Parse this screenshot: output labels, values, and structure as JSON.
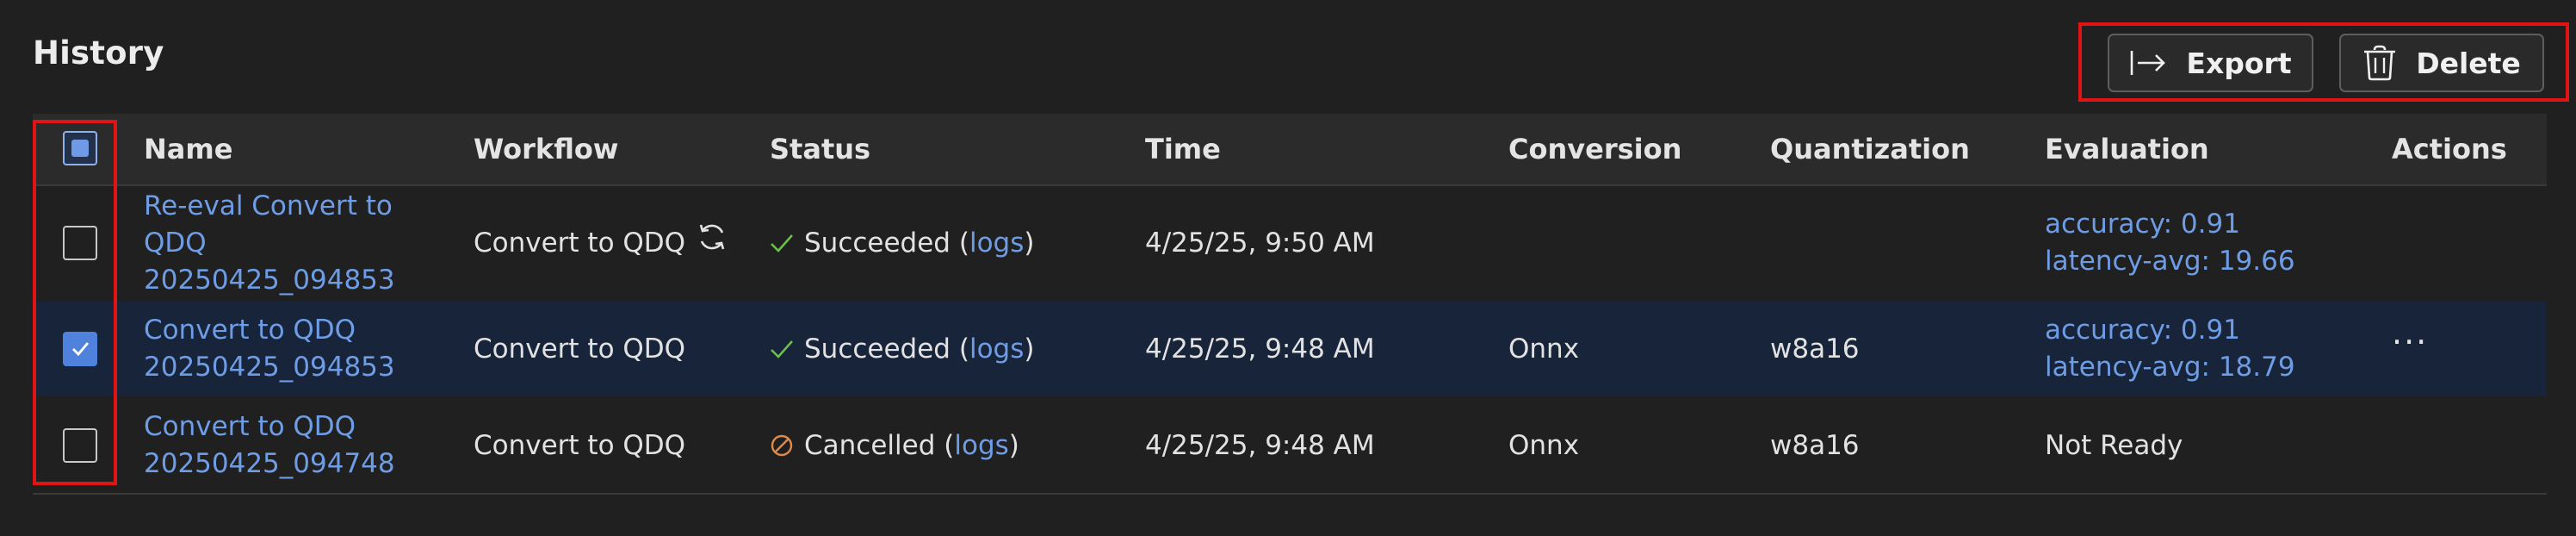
{
  "header": {
    "title": "History"
  },
  "toolbar": {
    "export_label": "Export",
    "export_icon": "arrow-right-to-line-icon",
    "delete_label": "Delete",
    "delete_icon": "trash-icon"
  },
  "table": {
    "columns": [
      "Name",
      "Workflow",
      "Status",
      "Time",
      "Conversion",
      "Quantization",
      "Evaluation",
      "Actions"
    ],
    "select_all_state": "indeterminate",
    "rows": [
      {
        "selected": false,
        "name_lines": [
          "Re-eval Convert to",
          "QDQ",
          "20250425_094853"
        ],
        "workflow": "Convert to QDQ",
        "workflow_icon": "refresh-icon",
        "status": "Succeeded",
        "status_icon": "checkmark-icon",
        "status_link": "logs",
        "time": "4/25/25, 9:50 AM",
        "conversion": "",
        "quantization": "",
        "evaluation_lines": [
          "accuracy: 0.91",
          "latency-avg: 19.66"
        ],
        "actions": ""
      },
      {
        "selected": true,
        "name_lines": [
          "Convert to QDQ",
          "20250425_094853"
        ],
        "workflow": "Convert to QDQ",
        "status": "Succeeded",
        "status_icon": "checkmark-icon",
        "status_link": "logs",
        "time": "4/25/25, 9:48 AM",
        "conversion": "Onnx",
        "quantization": "w8a16",
        "evaluation_lines": [
          "accuracy: 0.91",
          "latency-avg: 18.79"
        ],
        "actions": "···"
      },
      {
        "selected": false,
        "name_lines": [
          "Convert to QDQ",
          "20250425_094748"
        ],
        "workflow": "Convert to QDQ",
        "status": "Cancelled",
        "status_icon": "cancelled-icon",
        "status_link": "logs",
        "time": "4/25/25, 9:48 AM",
        "conversion": "Onnx",
        "quantization": "w8a16",
        "evaluation_text": "Not Ready",
        "actions": ""
      }
    ]
  },
  "colors": {
    "background": "#202020",
    "link": "#6e9de6",
    "selected_row": "#17243a",
    "success": "#6cc04a",
    "cancelled": "#e08a4a",
    "highlight_box": "#e01414"
  },
  "punct": {
    "open": "(",
    "close": ")"
  }
}
